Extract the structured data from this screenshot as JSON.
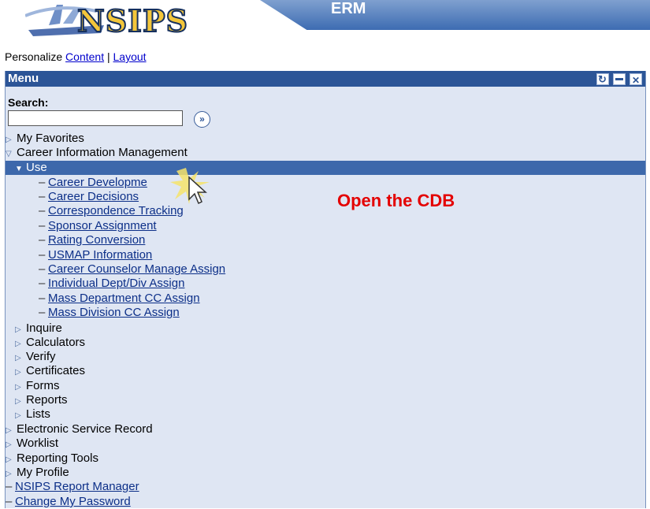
{
  "header": {
    "logo_text": "NSIPS",
    "banner_text": "ERM"
  },
  "personalize": {
    "label": "Personalize",
    "content_link": "Content",
    "separator": "|",
    "layout_link": "Layout"
  },
  "menu": {
    "title": "Menu",
    "search_label": "Search:",
    "search_value": "",
    "go_icon": "»",
    "top_items": [
      {
        "label": "My Favorites"
      },
      {
        "label": "Career Information Management"
      }
    ],
    "use_label": "Use",
    "use_links": [
      {
        "label": "Career Developme"
      },
      {
        "label": "Career Decisions"
      },
      {
        "label": "Correspondence Tracking"
      },
      {
        "label": "Sponsor Assignment"
      },
      {
        "label": "Rating Conversion"
      },
      {
        "label": "USMAP Information"
      },
      {
        "label": "Career Counselor Manage Assign"
      },
      {
        "label": "Individual Dept/Div Assign"
      },
      {
        "label": "Mass Department CC Assign"
      },
      {
        "label": "Mass Division CC Assign"
      }
    ],
    "sub_folders": [
      {
        "label": "Inquire"
      },
      {
        "label": "Calculators"
      },
      {
        "label": "Verify"
      },
      {
        "label": "Certificates"
      },
      {
        "label": "Forms"
      },
      {
        "label": "Reports"
      },
      {
        "label": "Lists"
      }
    ],
    "root_folders": [
      {
        "label": "Electronic Service Record"
      },
      {
        "label": "Worklist"
      },
      {
        "label": "Reporting Tools"
      },
      {
        "label": "My Profile"
      }
    ],
    "root_links": [
      {
        "label": "NSIPS Report Manager"
      },
      {
        "label": "Change My Password"
      }
    ]
  },
  "callout": {
    "text": "Open the CDB",
    "color": "#e40000"
  },
  "colors": {
    "header_blue": "#2c5597",
    "selected_row": "#3d68ab",
    "menu_bg": "#dfe6f3"
  }
}
